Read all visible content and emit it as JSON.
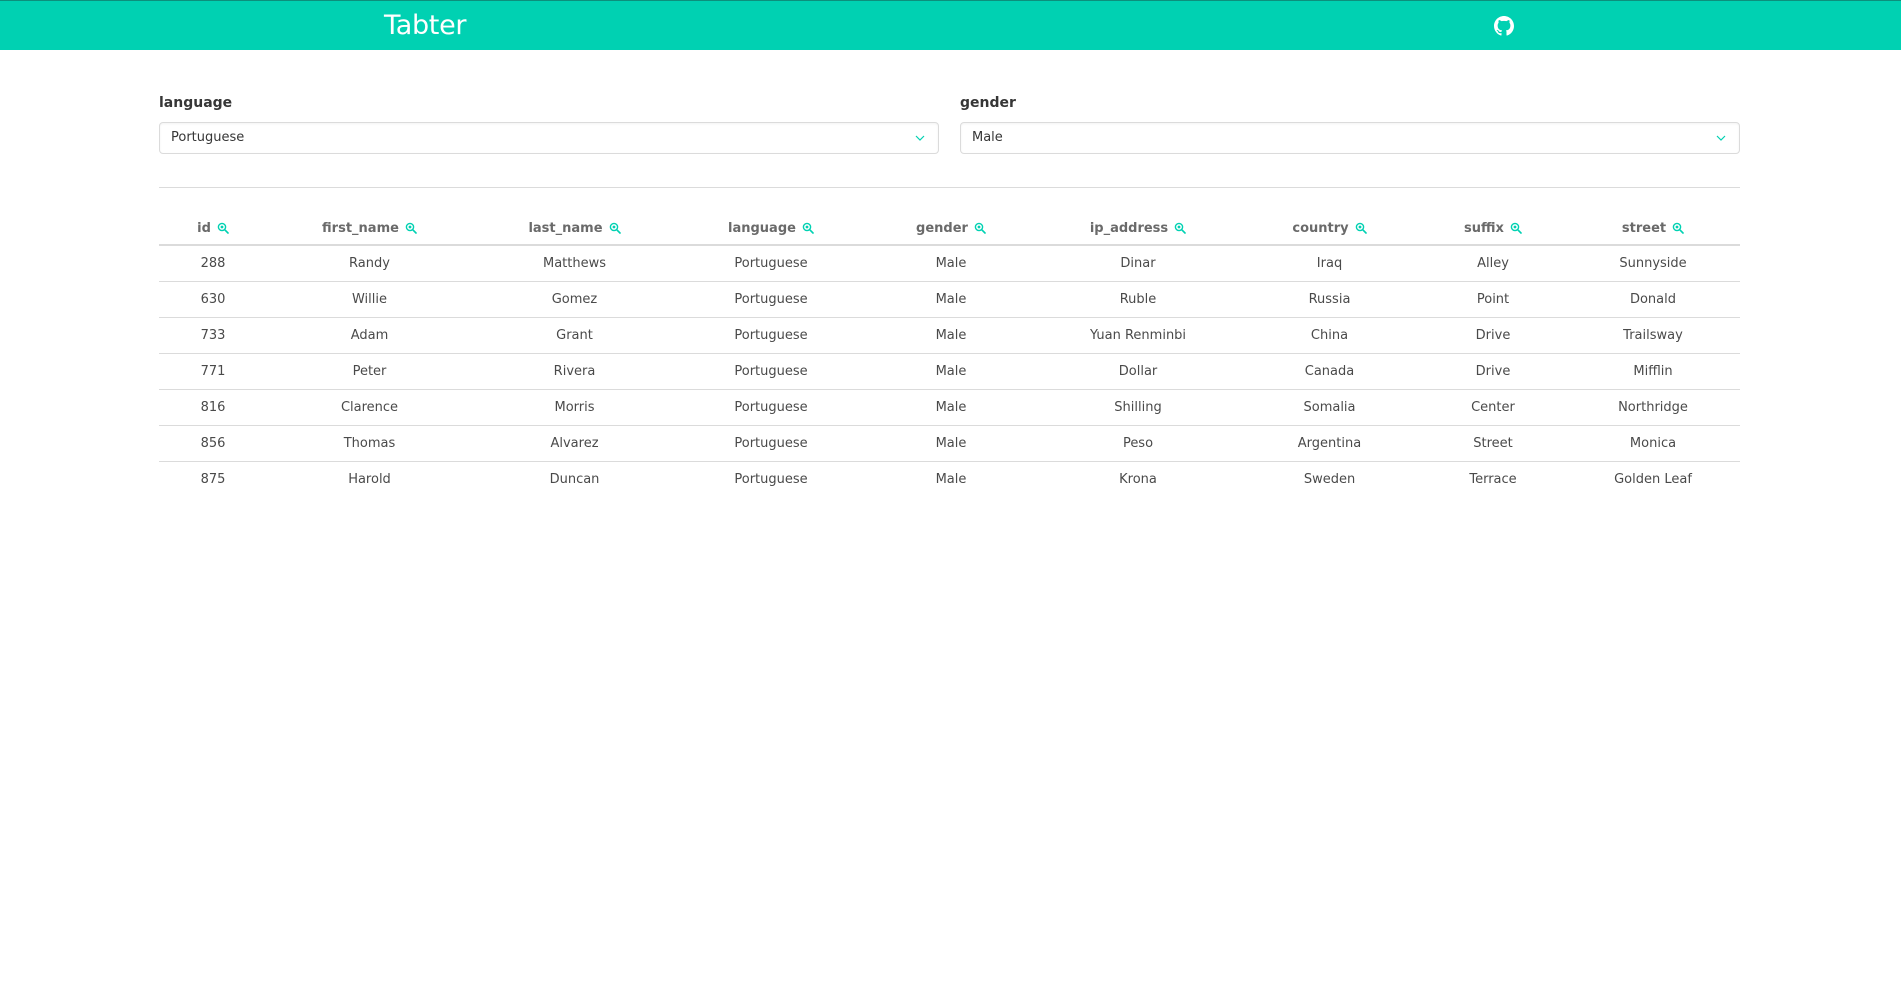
{
  "navbar": {
    "brand": "Tabter",
    "github_icon": "github-icon",
    "background_color": "#00d1b2"
  },
  "filters": [
    {
      "label": "language",
      "selected": "Portuguese"
    },
    {
      "label": "gender",
      "selected": "Male"
    }
  ],
  "table": {
    "columns": [
      "id",
      "first_name",
      "last_name",
      "language",
      "gender",
      "ip_address",
      "country",
      "suffix",
      "street"
    ],
    "rows": [
      [
        "288",
        "Randy",
        "Matthews",
        "Portuguese",
        "Male",
        "Dinar",
        "Iraq",
        "Alley",
        "Sunnyside"
      ],
      [
        "630",
        "Willie",
        "Gomez",
        "Portuguese",
        "Male",
        "Ruble",
        "Russia",
        "Point",
        "Donald"
      ],
      [
        "733",
        "Adam",
        "Grant",
        "Portuguese",
        "Male",
        "Yuan Renminbi",
        "China",
        "Drive",
        "Trailsway"
      ],
      [
        "771",
        "Peter",
        "Rivera",
        "Portuguese",
        "Male",
        "Dollar",
        "Canada",
        "Drive",
        "Mifflin"
      ],
      [
        "816",
        "Clarence",
        "Morris",
        "Portuguese",
        "Male",
        "Shilling",
        "Somalia",
        "Center",
        "Northridge"
      ],
      [
        "856",
        "Thomas",
        "Alvarez",
        "Portuguese",
        "Male",
        "Peso",
        "Argentina",
        "Street",
        "Monica"
      ],
      [
        "875",
        "Harold",
        "Duncan",
        "Portuguese",
        "Male",
        "Krona",
        "Sweden",
        "Terrace",
        "Golden Leaf"
      ]
    ]
  },
  "colors": {
    "accent": "#00d1b2",
    "border": "#dbdbdb",
    "text": "#4a4a4a"
  }
}
